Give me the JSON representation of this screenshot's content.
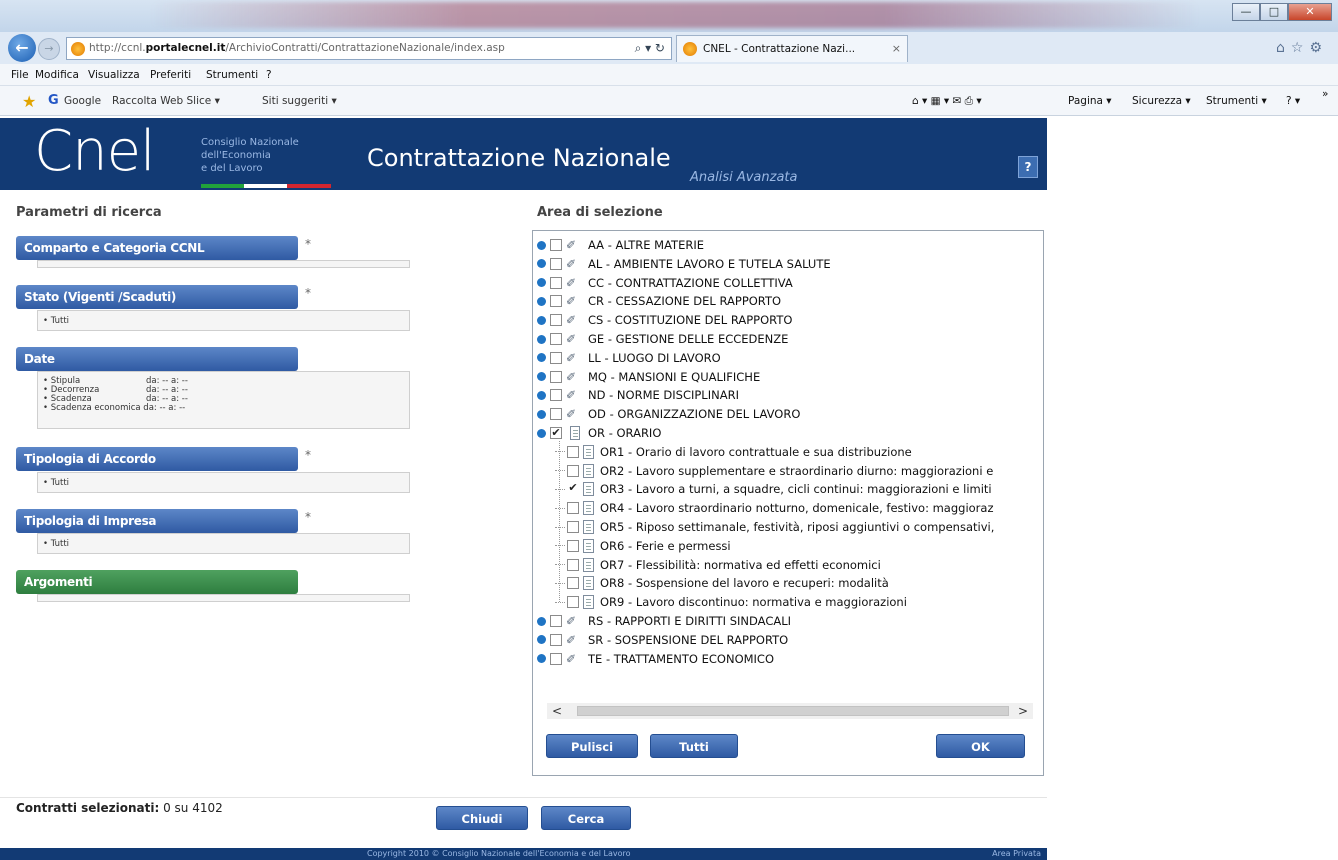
{
  "browser": {
    "url_prefix": "http://ccnl.",
    "url_domain": "portalecnel.it",
    "url_path": "/ArchivioContratti/ContrattazioneNazionale/index.asp",
    "url_controls": "⌕ ▾ ↻",
    "tab_title": "CNEL - Contrattazione Nazi...",
    "tab_close": "×",
    "right_icons": "⌂☆⚙",
    "window_buttons": {
      "minimize": "—",
      "maximize": "□",
      "close": "✕"
    },
    "back": "←",
    "forward": "→",
    "menu": [
      "File",
      "Modifica",
      "Visualizza",
      "Preferiti",
      "Strumenti",
      "?"
    ],
    "favorites": {
      "star": "★",
      "google_icon": "G",
      "google": "Google",
      "webslice": "Raccolta Web Slice ▾",
      "suggested": "Siti suggeriti ▾"
    },
    "commands": {
      "icons": "⌂ ▾  ▦ ▾  ✉  ⎙ ▾",
      "pagina": "Pagina ▾",
      "sicurezza": "Sicurezza ▾",
      "strumenti": "Strumenti ▾",
      "help": "? ▾",
      "more": "»"
    }
  },
  "header": {
    "logo": "Cnel",
    "org_line1": "Consiglio Nazionale",
    "org_line2": "dell'Economia",
    "org_line3": "e del Lavoro",
    "title": "Contrattazione Nazionale",
    "subtitle": "Analisi Avanzata",
    "help": "?"
  },
  "left": {
    "title": "Parametri di ricerca",
    "required_mark": "*",
    "sections": {
      "comparto": {
        "label": "Comparto e Categoria CCNL"
      },
      "stato": {
        "label": "Stato (Vigenti /Scaduti)",
        "value": "• Tutti"
      },
      "date": {
        "label": "Date",
        "rows": [
          {
            "name": "• Stipula",
            "value": "da: -- a: --"
          },
          {
            "name": "• Decorrenza",
            "value": "da: -- a: --"
          },
          {
            "name": "• Scadenza",
            "value": "da: -- a: --"
          },
          {
            "name": "• Scadenza economica",
            "value": "da: -- a: --"
          }
        ]
      },
      "accordo": {
        "label": "Tipologia di Accordo",
        "value": "• Tutti"
      },
      "impresa": {
        "label": "Tipologia di Impresa",
        "value": "• Tutti"
      },
      "argomenti": {
        "label": "Argomenti"
      }
    }
  },
  "right": {
    "title": "Area di selezione",
    "folder_glyph": "✐",
    "check_glyph": "✔",
    "tree_top": [
      "AA - ALTRE MATERIE",
      "AL - AMBIENTE LAVORO E TUTELA SALUTE",
      "CC - CONTRATTAZIONE COLLETTIVA",
      "CR - CESSAZIONE DEL RAPPORTO",
      "CS - COSTITUZIONE DEL RAPPORTO",
      "GE - GESTIONE DELLE ECCEDENZE",
      "LL - LUOGO DI LAVORO",
      "MQ - MANSIONI E QUALIFICHE",
      "ND - NORME DISCIPLINARI",
      "OD - ORGANIZZAZIONE DEL LAVORO"
    ],
    "expanded": {
      "label": "OR - ORARIO",
      "checked": true
    },
    "children": [
      {
        "label": "OR1 - Orario di lavoro contrattuale e sua distribuzione",
        "checked": false
      },
      {
        "label": "OR2 - Lavoro supplementare e straordinario diurno: maggiorazioni e",
        "checked": false
      },
      {
        "label": "OR3 - Lavoro a turni, a squadre, cicli continui: maggiorazioni e limiti",
        "checked": true
      },
      {
        "label": "OR4 - Lavoro straordinario notturno, domenicale, festivo: maggioraz",
        "checked": false
      },
      {
        "label": "OR5 - Riposo settimanale, festività, riposi aggiuntivi o compensativi,",
        "checked": false
      },
      {
        "label": "OR6 - Ferie e permessi",
        "checked": false
      },
      {
        "label": "OR7 - Flessibilità: normativa ed effetti economici",
        "checked": false
      },
      {
        "label": "OR8 - Sospensione del lavoro e recuperi: modalità",
        "checked": false
      },
      {
        "label": "OR9 - Lavoro discontinuo: normativa e maggiorazioni",
        "checked": false
      }
    ],
    "tree_bottom": [
      "RS - RAPPORTI E DIRITTI SINDACALI",
      "SR - SOSPENSIONE DEL RAPPORTO",
      "TE - TRATTAMENTO ECONOMICO"
    ],
    "scroll_left": "<",
    "scroll_right": ">",
    "buttons": {
      "pulisci": "Pulisci",
      "tutti": "Tutti",
      "ok": "OK"
    }
  },
  "bottom": {
    "counter_label": "Contratti selezionati:",
    "counter_value": "0 su 4102",
    "chiudi": "Chiudi",
    "cerca": "Cerca",
    "copyright": "Copyright 2010 © Consiglio Nazionale dell'Economia e del Lavoro",
    "area_privata": "Area Privata"
  }
}
